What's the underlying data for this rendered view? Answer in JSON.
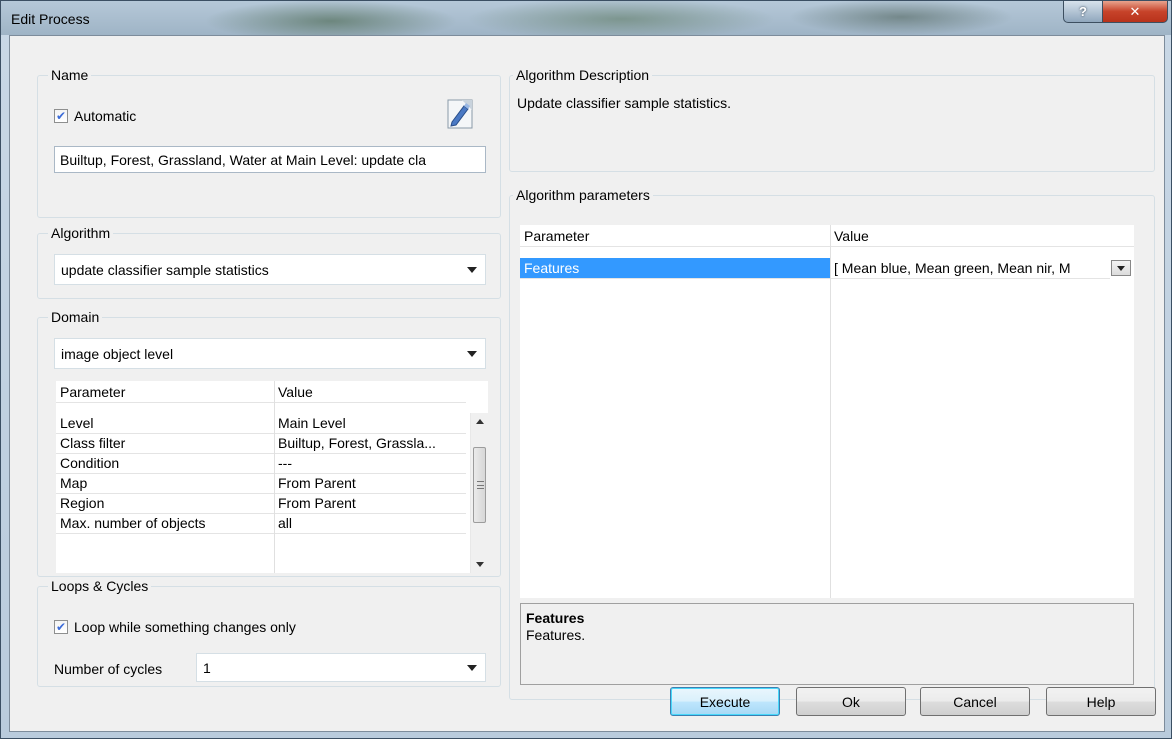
{
  "window": {
    "title": "Edit Process"
  },
  "name_group": {
    "label": "Name",
    "automatic_label": "Automatic",
    "automatic_checked": true,
    "name_value": "Builtup, Forest, Grassland, Water at  Main Level: update cla"
  },
  "algorithm_group": {
    "label": "Algorithm",
    "selected": "update classifier sample statistics"
  },
  "domain_group": {
    "label": "Domain",
    "selected": "image object level",
    "columns": [
      "Parameter",
      "Value"
    ],
    "rows": [
      {
        "parameter": "Level",
        "value": "Main Level"
      },
      {
        "parameter": "Class filter",
        "value": "Builtup, Forest, Grassla..."
      },
      {
        "parameter": "Condition",
        "value": "---"
      },
      {
        "parameter": "Map",
        "value": "From Parent"
      },
      {
        "parameter": "Region",
        "value": "From Parent"
      },
      {
        "parameter": "Max. number of objects",
        "value": "all"
      }
    ]
  },
  "loops_group": {
    "label": "Loops & Cycles",
    "loop_label": "Loop while something changes only",
    "loop_checked": true,
    "cycles_label": "Number of cycles",
    "cycles_value": "1"
  },
  "description_group": {
    "label": "Algorithm Description",
    "text": "Update classifier sample statistics."
  },
  "parameters_group": {
    "label": "Algorithm parameters",
    "columns": [
      "Parameter",
      "Value"
    ],
    "rows": [
      {
        "parameter": "Features",
        "value": "[ Mean blue, Mean green, Mean nir, M"
      }
    ],
    "detail_title": "Features",
    "detail_text": "Features."
  },
  "buttons": {
    "execute": "Execute",
    "ok": "Ok",
    "cancel": "Cancel",
    "help": "Help"
  },
  "colors": {
    "selection": "#3399ff",
    "close_button": "#c7432a"
  }
}
